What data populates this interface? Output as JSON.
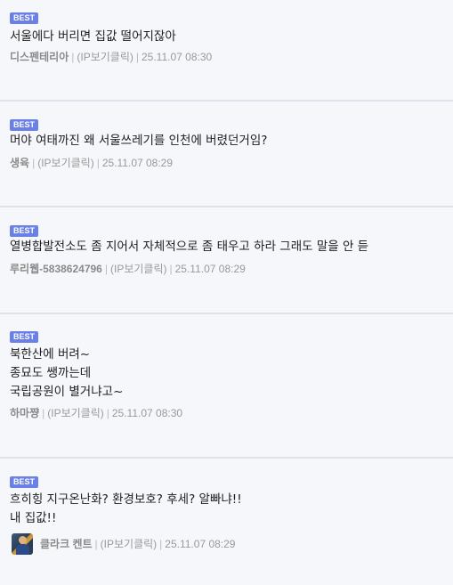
{
  "comments": [
    {
      "badge": "BEST",
      "lines": [
        "서울에다 버리면 집값 떨어지잖아"
      ],
      "nick": "디스펜테리아",
      "ip": "(IP보기클릭)",
      "date": "25.11.07 08:30"
    },
    {
      "badge": "BEST",
      "lines": [
        "머야 여태까진 왜 서울쓰레기를 인천에 버렸던거임?"
      ],
      "nick": "생육",
      "ip": "(IP보기클릭)",
      "date": "25.11.07 08:29"
    },
    {
      "badge": "BEST",
      "lines": [
        "열병합발전소도 좀 지어서 자체적으로 좀 태우고 하라 그래도 말을 안 듣"
      ],
      "nick": "루리웹-5838624796",
      "ip": "(IP보기클릭)",
      "date": "25.11.07 08:29"
    },
    {
      "badge": "BEST",
      "lines": [
        "북한산에 버려~",
        "종묘도 쌩까는데",
        "국립공원이 별거냐고~"
      ],
      "nick": "하마쨩",
      "ip": "(IP보기클릭)",
      "date": "25.11.07 08:30"
    },
    {
      "badge": "BEST",
      "lines": [
        "흐히힝 지구온난화? 환경보호? 후세? 알빠냐!!",
        "내 집값!!"
      ],
      "nick": "클라크 켄트",
      "ip": "(IP보기클릭)",
      "date": "25.11.07 08:29",
      "avatar": "superman-avatar"
    }
  ]
}
